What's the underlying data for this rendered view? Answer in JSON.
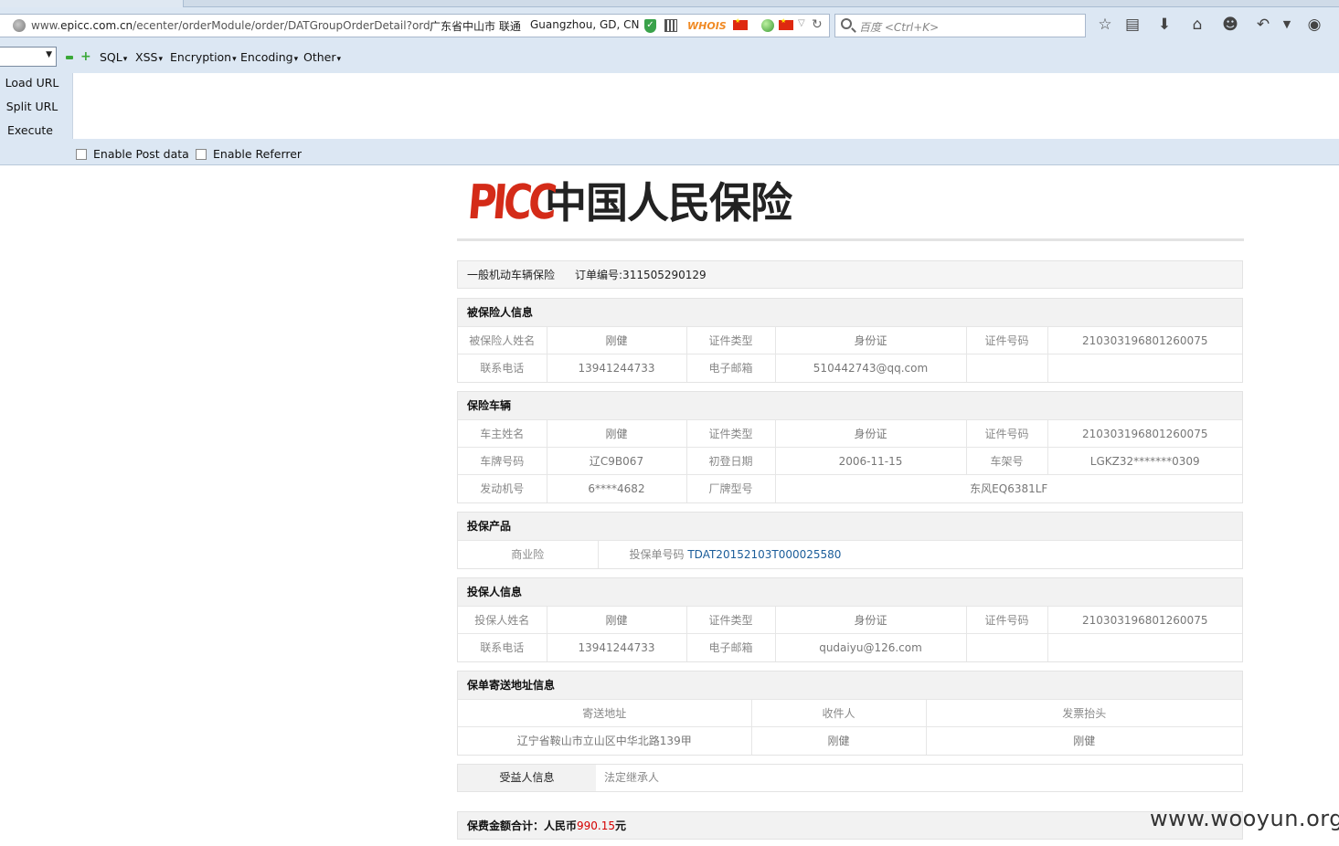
{
  "browser": {
    "url_prefix": "www.",
    "url_domain": "epicc.com.cn",
    "url_path": "/ecenter/orderModule/order/DATGroupOrderDetail?ord",
    "geo_region": "广东省中山市 联通",
    "geo_city": "Guangzhou, GD, CN",
    "whois_label": "WHOIS",
    "search_placeholder": "百度 <Ctrl+K>",
    "toolbar_icons": [
      "star-icon",
      "reading-list-icon",
      "download-icon",
      "home-icon",
      "chat-icon",
      "undo-icon",
      "menu-arrow-icon",
      "comment-icon"
    ]
  },
  "hackbar": {
    "menus": [
      "SQL",
      "XSS",
      "Encryption",
      "Encoding",
      "Other"
    ],
    "load_url": "Load URL",
    "split_url": "Split URL",
    "execute": "Execute",
    "enable_post": "Enable Post data",
    "enable_referrer": "Enable Referrer"
  },
  "page": {
    "logo_latin": "PICC",
    "logo_cn": "中国人民保险",
    "order_type": "一般机动车辆保险",
    "order_no": "订单编号:311505290129",
    "insured": {
      "title": "被保险人信息",
      "rows": [
        [
          "被保险人姓名",
          "刚健",
          "证件类型",
          "身份证",
          "证件号码",
          "210303196801260075"
        ],
        [
          "联系电话",
          "13941244733",
          "电子邮箱",
          "510442743@qq.com",
          "",
          ""
        ]
      ]
    },
    "vehicle": {
      "title": "保险车辆",
      "rows": [
        [
          "车主姓名",
          "刚健",
          "证件类型",
          "身份证",
          "证件号码",
          "210303196801260075"
        ],
        [
          "车牌号码",
          "辽C9B067",
          "初登日期",
          "2006-11-15",
          "车架号",
          "LGKZ32*******0309"
        ],
        [
          "发动机号",
          "6****4682",
          "厂牌型号",
          "东风EQ6381LF"
        ]
      ]
    },
    "product": {
      "title": "投保产品",
      "name": "商业险",
      "policy_label": "投保单号码",
      "policy_no": "TDAT20152103T000025580"
    },
    "applicant": {
      "title": "投保人信息",
      "rows": [
        [
          "投保人姓名",
          "刚健",
          "证件类型",
          "身份证",
          "证件号码",
          "210303196801260075"
        ],
        [
          "联系电话",
          "13941244733",
          "电子邮箱",
          "qudaiyu@126.com",
          "",
          ""
        ]
      ]
    },
    "delivery": {
      "title": "保单寄送地址信息",
      "headers": [
        "寄送地址",
        "收件人",
        "发票抬头"
      ],
      "values": [
        "辽宁省鞍山市立山区中华北路139甲",
        "刚健",
        "刚健"
      ]
    },
    "beneficiary": {
      "label": "受益人信息",
      "value": "法定继承人"
    },
    "total": {
      "label": "保费金额合计：人民币",
      "amount": "990.15",
      "unit": "元"
    }
  },
  "watermark": "www.wooyun.org"
}
